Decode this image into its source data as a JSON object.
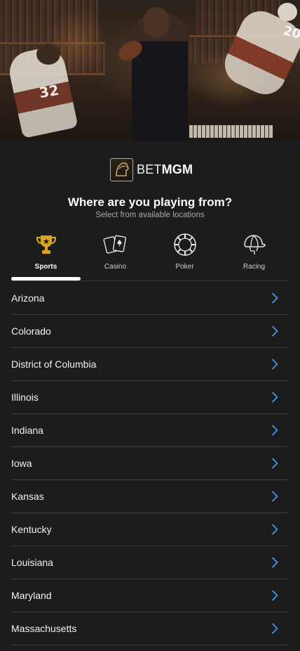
{
  "hero": {
    "jersey_left": "32",
    "jersey_right": "20"
  },
  "brand": {
    "bet": "BET",
    "mgm": "MGM",
    "gold": "#c9a96a"
  },
  "header": {
    "title": "Where are you playing from?",
    "subtitle": "Select from available locations"
  },
  "tabs": [
    {
      "label": "Sports",
      "icon": "trophy-icon",
      "active": true
    },
    {
      "label": "Casino",
      "icon": "playing-cards-icon",
      "active": false
    },
    {
      "label": "Poker",
      "icon": "poker-chip-icon",
      "active": false
    },
    {
      "label": "Racing",
      "icon": "jockey-helmet-icon",
      "active": false
    }
  ],
  "locations": [
    {
      "label": "Arizona"
    },
    {
      "label": "Colorado"
    },
    {
      "label": "District of Columbia"
    },
    {
      "label": "Illinois"
    },
    {
      "label": "Indiana"
    },
    {
      "label": "Iowa"
    },
    {
      "label": "Kansas"
    },
    {
      "label": "Kentucky"
    },
    {
      "label": "Louisiana"
    },
    {
      "label": "Maryland"
    },
    {
      "label": "Massachusetts"
    }
  ],
  "colors": {
    "background": "#1c1c1c",
    "chevron": "#3d9be9",
    "divider": "#3a3a3a"
  }
}
